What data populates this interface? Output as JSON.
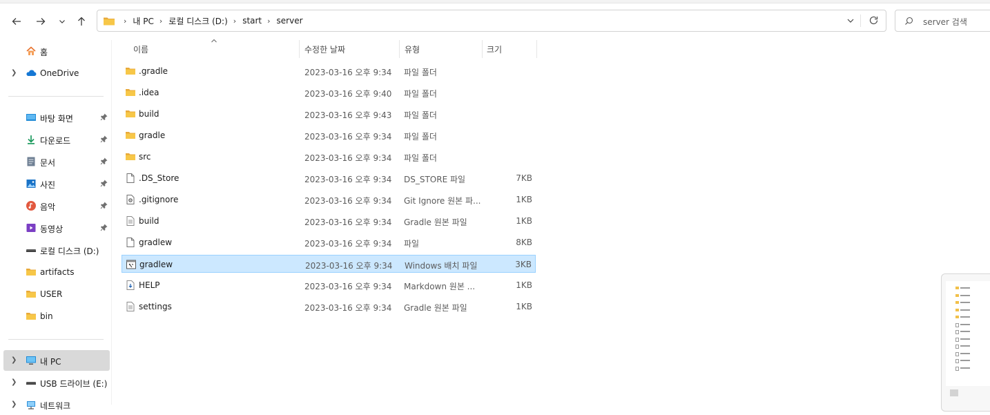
{
  "address": {
    "crumbs": [
      "내 PC",
      "로컬 디스크 (D:)",
      "start",
      "server"
    ],
    "search_placeholder": "server 검색"
  },
  "sidebar": {
    "items": [
      {
        "label": "홈",
        "icon": "home-icon"
      },
      {
        "label": "OneDrive",
        "icon": "cloud-icon"
      },
      {
        "label": "바탕 화면",
        "icon": "desktop-icon"
      },
      {
        "label": "다운로드",
        "icon": "download-icon"
      },
      {
        "label": "문서",
        "icon": "document-icon"
      },
      {
        "label": "사진",
        "icon": "pictures-icon"
      },
      {
        "label": "음악",
        "icon": "music-icon"
      },
      {
        "label": "동영상",
        "icon": "video-icon"
      },
      {
        "label": "로컬 디스크 (D:)",
        "icon": "drive-icon"
      },
      {
        "label": "artifacts",
        "icon": "folder-icon"
      },
      {
        "label": "USER",
        "icon": "folder-icon"
      },
      {
        "label": "bin",
        "icon": "folder-icon"
      },
      {
        "label": "내 PC",
        "icon": "pc-icon"
      },
      {
        "label": "USB 드라이브 (E:)",
        "icon": "usb-drive-icon"
      },
      {
        "label": "네트워크",
        "icon": "network-icon"
      }
    ]
  },
  "columns": {
    "name": "이름",
    "date": "수정한 날짜",
    "type": "유형",
    "size": "크기"
  },
  "files": [
    {
      "name": ".gradle",
      "date": "2023-03-16 오후 9:34",
      "type": "파일 폴더",
      "size": "",
      "icon": "folder-icon"
    },
    {
      "name": ".idea",
      "date": "2023-03-16 오후 9:40",
      "type": "파일 폴더",
      "size": "",
      "icon": "folder-icon"
    },
    {
      "name": "build",
      "date": "2023-03-16 오후 9:43",
      "type": "파일 폴더",
      "size": "",
      "icon": "folder-icon"
    },
    {
      "name": "gradle",
      "date": "2023-03-16 오후 9:34",
      "type": "파일 폴더",
      "size": "",
      "icon": "folder-icon"
    },
    {
      "name": "src",
      "date": "2023-03-16 오후 9:34",
      "type": "파일 폴더",
      "size": "",
      "icon": "folder-icon"
    },
    {
      "name": ".DS_Store",
      "date": "2023-03-16 오후 9:34",
      "type": "DS_STORE 파일",
      "size": "7KB",
      "icon": "blank-file-icon"
    },
    {
      "name": ".gitignore",
      "date": "2023-03-16 오후 9:34",
      "type": "Git Ignore 원본 파...",
      "size": "1KB",
      "icon": "settings-file-icon"
    },
    {
      "name": "build",
      "date": "2023-03-16 오후 9:34",
      "type": "Gradle 원본 파일",
      "size": "1KB",
      "icon": "text-file-icon"
    },
    {
      "name": "gradlew",
      "date": "2023-03-16 오후 9:34",
      "type": "파일",
      "size": "8KB",
      "icon": "blank-file-icon"
    },
    {
      "name": "gradlew",
      "date": "2023-03-16 오후 9:34",
      "type": "Windows 배치 파일",
      "size": "3KB",
      "icon": "batch-file-icon",
      "selected": true
    },
    {
      "name": "HELP",
      "date": "2023-03-16 오후 9:34",
      "type": "Markdown 원본 ...",
      "size": "1KB",
      "icon": "markdown-file-icon"
    },
    {
      "name": "settings",
      "date": "2023-03-16 오후 9:34",
      "type": "Gradle 원본 파일",
      "size": "1KB",
      "icon": "text-file-icon"
    }
  ],
  "colors": {
    "selection_bg": "#cce8ff",
    "selection_border": "#99d1ff",
    "folder": "#f2c04a"
  }
}
